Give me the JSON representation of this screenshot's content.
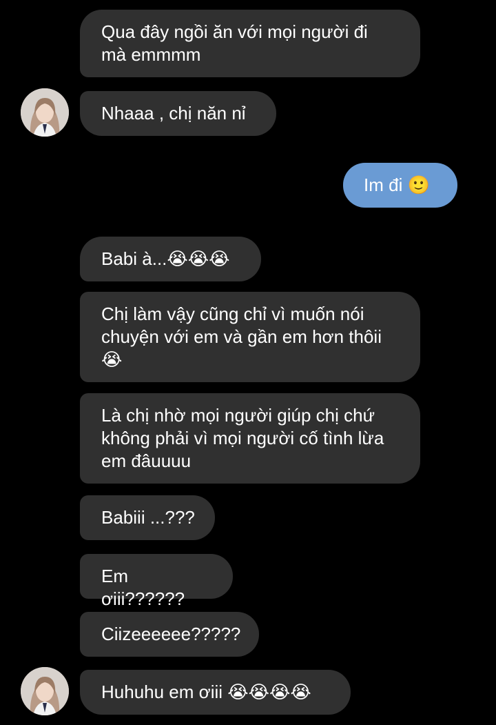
{
  "conversation": {
    "messages": [
      {
        "sender": "contact",
        "text": "Qua đây ngồi ăn với mọi người đi\nmà emmmm"
      },
      {
        "sender": "contact",
        "text": "Nhaaa , chị năn nỉ"
      },
      {
        "sender": "me",
        "text": "Im đi 🙂"
      },
      {
        "sender": "contact",
        "text": "Babi à...😭😭😭"
      },
      {
        "sender": "contact",
        "text": "Chị làm vậy cũng chỉ vì muốn nói\nchuyện với em và gần em hơn thôii\n😭"
      },
      {
        "sender": "contact",
        "text": "Là chị nhờ mọi người giúp chị chứ\nkhông phải vì mọi người cố tình lừa\nem đâuuuu"
      },
      {
        "sender": "contact",
        "text": "Babiii ...???"
      },
      {
        "sender": "contact",
        "text": "Em ơiii??????"
      },
      {
        "sender": "contact",
        "text": "Ciizeeeeee?????"
      },
      {
        "sender": "contact",
        "text": "Huhuhu em ơiii 😭😭😭😭"
      }
    ]
  },
  "colors": {
    "background": "#000000",
    "incoming_bubble": "#303030",
    "outgoing_bubble": "#6a9bd4",
    "text": "#ffffff"
  },
  "icons": {
    "contact_avatar": "contact-avatar-photo"
  }
}
